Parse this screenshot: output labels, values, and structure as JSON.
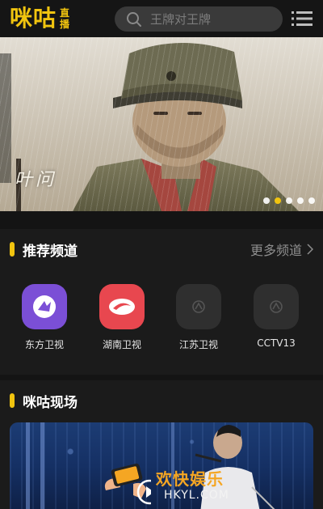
{
  "header": {
    "logo_text": "咪咕",
    "logo_sub_line1": "直",
    "logo_sub_line2": "播",
    "search_placeholder": "王牌对王牌",
    "accent_color": "#f1c40f"
  },
  "banner": {
    "poster_text": "叶问",
    "slide_count": 5,
    "active_slide": 2
  },
  "channels_section": {
    "title": "推荐频道",
    "more_label": "更多频道",
    "channels": [
      {
        "label": "东方卫视",
        "icon": "dragon-tv-icon",
        "color": "#7b4fd6"
      },
      {
        "label": "湖南卫视",
        "icon": "hunan-tv-icon",
        "color": "#e8474f"
      },
      {
        "label": "江苏卫视",
        "icon": "jiangsu-tv-icon",
        "color": "#2f2f2f"
      },
      {
        "label": "CCTV13",
        "icon": "cctv13-icon",
        "color": "#2f2f2f"
      }
    ]
  },
  "live_section": {
    "title": "咪咕现场"
  },
  "watermark": {
    "text": "欢快娱乐",
    "url": "HKYL.COM"
  }
}
